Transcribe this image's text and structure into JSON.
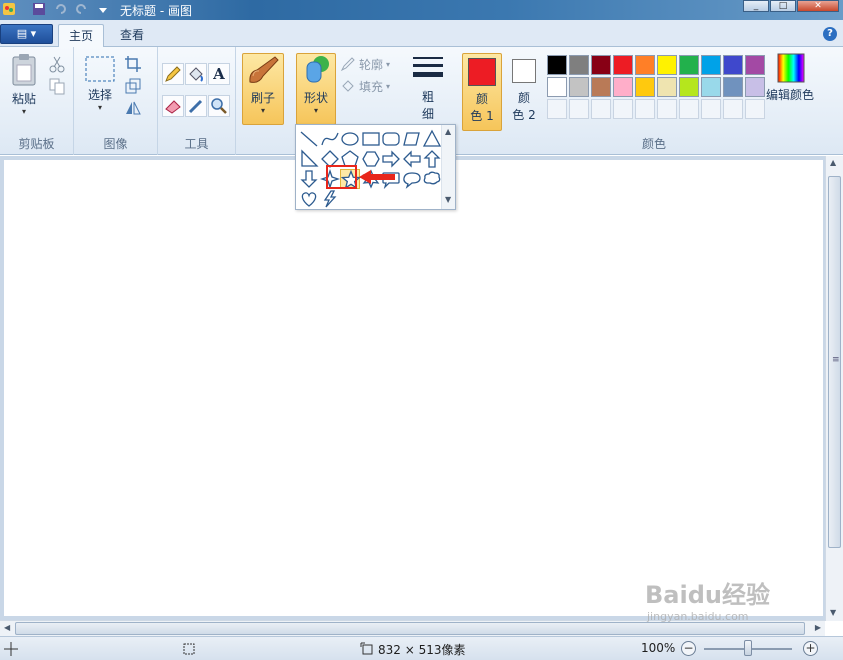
{
  "window": {
    "title": "无标题 - 画图"
  },
  "tabs": {
    "home": "主页",
    "view": "查看"
  },
  "ribbon": {
    "clipboard": {
      "paste": "粘贴",
      "group_label": "剪贴板"
    },
    "image": {
      "select": "选择",
      "group_label": "图像"
    },
    "tools": {
      "text_tool": "A",
      "group_label": "工具"
    },
    "brushes": {
      "label": "刷子"
    },
    "shapes": {
      "label": "形状",
      "outline": "轮廓",
      "fill": "填充"
    },
    "size": {
      "label_line1": "粗",
      "label_line2": "细"
    },
    "color1": {
      "line1": "颜",
      "line2": "色 1",
      "value": "#ed1c24"
    },
    "color2": {
      "line1": "颜",
      "line2": "色 2",
      "value": "#ffffff"
    },
    "colors": {
      "group_label": "颜色",
      "edit_colors": "编辑颜色",
      "row1": [
        "#000000",
        "#7f7f7f",
        "#880015",
        "#ed1c24",
        "#ff7f27",
        "#fff200",
        "#22b14c",
        "#00a2e8",
        "#3f48cc",
        "#a349a4"
      ],
      "row2": [
        "#ffffff",
        "#c3c3c3",
        "#b97a57",
        "#ffaec9",
        "#ffc90e",
        "#efe4b0",
        "#b5e61d",
        "#99d9ea",
        "#7092be",
        "#c8bfe7"
      ]
    }
  },
  "shapes_menu": {
    "items": [
      "line-icon",
      "curve-icon",
      "oval-icon",
      "rectangle-icon",
      "rounded-rectangle-icon",
      "polygon-icon",
      "triangle-icon",
      "right-triangle-icon",
      "diamond-icon",
      "pentagon-icon",
      "hexagon-icon",
      "right-arrow-icon",
      "left-arrow-icon",
      "up-arrow-icon",
      "down-arrow-icon",
      "four-point-star-icon",
      "five-point-star-icon",
      "six-point-star-icon",
      "rounded-callout-icon",
      "oval-callout-icon",
      "cloud-callout-icon",
      "heart-icon",
      "lightning-icon"
    ],
    "selected": "five-point-star-icon"
  },
  "status": {
    "dimensions": "832 × 513像素",
    "zoom": "100%"
  },
  "watermark": {
    "main": "Baidu经验",
    "sub": "jingyan.baidu.com"
  }
}
